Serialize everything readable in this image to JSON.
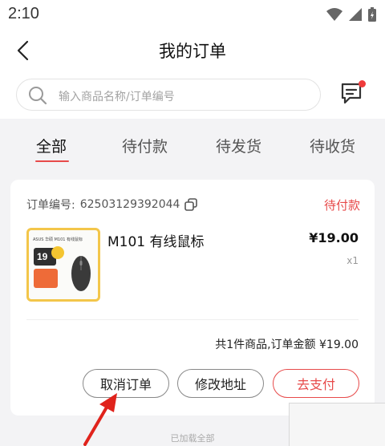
{
  "status_bar": {
    "time": "2:10"
  },
  "header": {
    "title": "我的订单"
  },
  "search": {
    "placeholder": "输入商品名称/订单编号"
  },
  "tabs": [
    {
      "label": "全部",
      "active": true
    },
    {
      "label": "待付款",
      "active": false
    },
    {
      "label": "待发货",
      "active": false
    },
    {
      "label": "待收货",
      "active": false
    }
  ],
  "order": {
    "number_label": "订单编号:",
    "number": "62503129392044",
    "status": "待付款",
    "product": {
      "name": "M101 有线鼠标",
      "price": "¥19.00",
      "quantity": "x1",
      "thumb_brand": "ASUS 华硕 M101 有线鼠标",
      "thumb_price": "19"
    },
    "summary": "共1件商品,订单金额 ¥19.00",
    "actions": {
      "cancel": "取消订单",
      "change_address": "修改地址",
      "pay": "去支付"
    }
  },
  "footer": {
    "loaded_all": "已加载全部"
  },
  "colors": {
    "accent": "#e74a4a",
    "thumb_border": "#f3c64a"
  }
}
